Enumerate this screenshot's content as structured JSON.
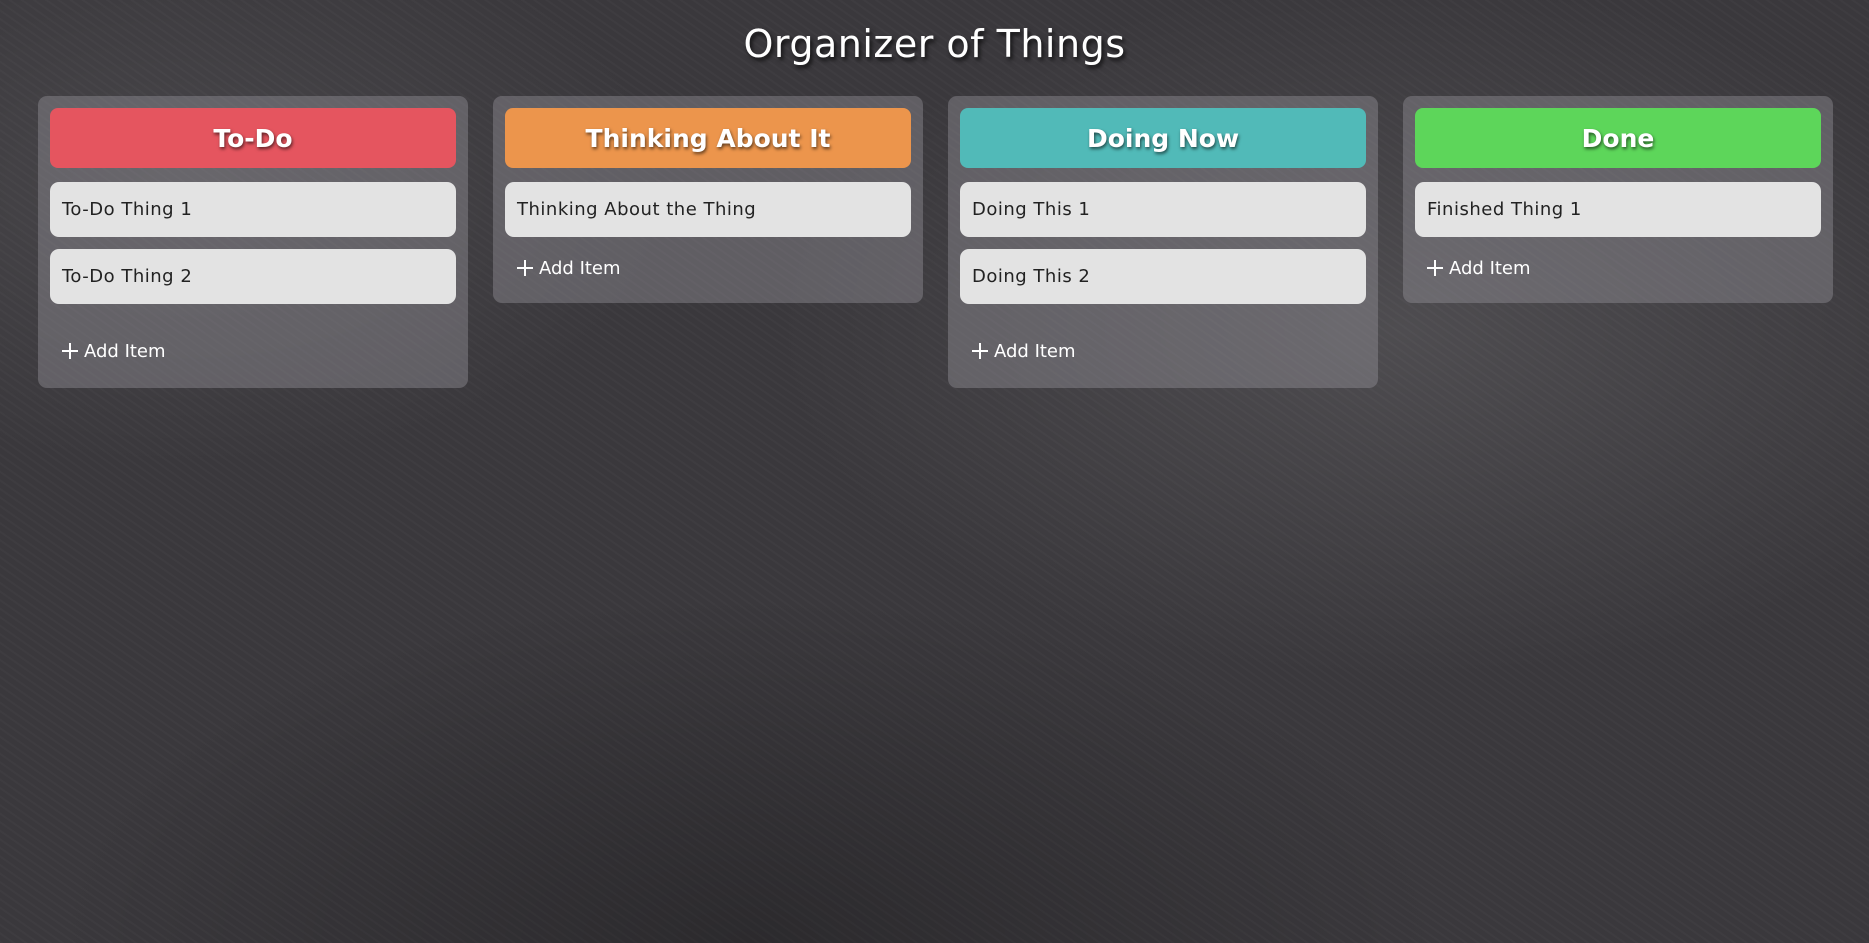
{
  "page": {
    "title": "Organizer of Things"
  },
  "add_item_label": "Add Item",
  "columns": [
    {
      "title": "To-Do",
      "color": "#e5555f",
      "items": [
        "To-Do Thing 1",
        "To-Do Thing 2"
      ]
    },
    {
      "title": "Thinking About It",
      "color": "#ec954c",
      "items": [
        "Thinking About the Thing"
      ]
    },
    {
      "title": "Doing Now",
      "color": "#51bab8",
      "items": [
        "Doing This 1",
        "Doing This 2"
      ]
    },
    {
      "title": "Done",
      "color": "#5dd65a",
      "items": [
        "Finished Thing 1"
      ]
    }
  ],
  "icons": {
    "add": "plus-icon"
  }
}
